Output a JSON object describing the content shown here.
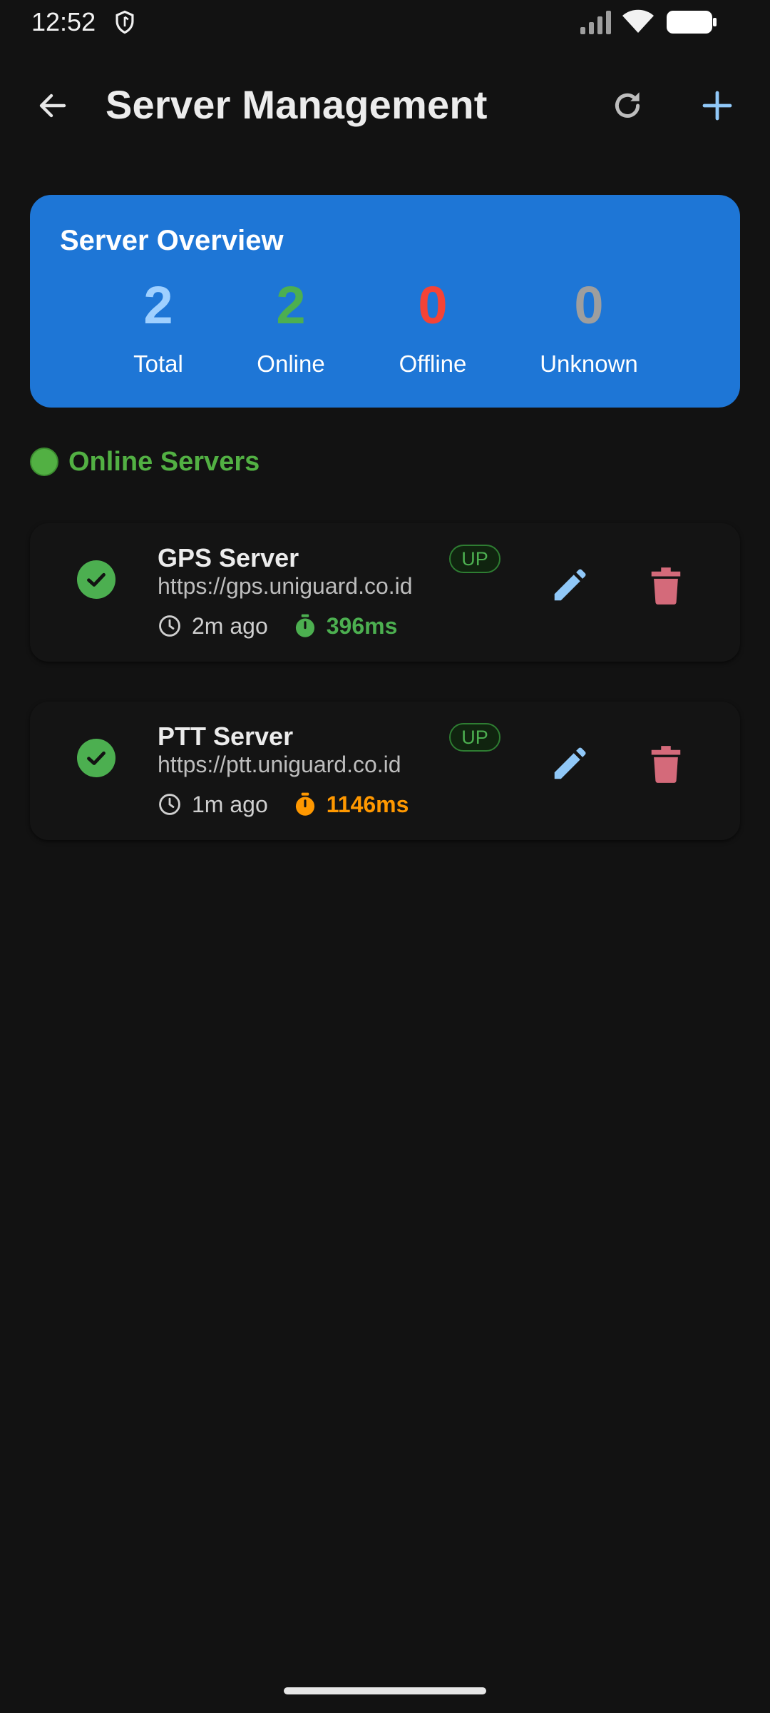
{
  "status_bar": {
    "time": "12:52",
    "icons": [
      "shield-icon",
      "signal-icon",
      "wifi-icon",
      "battery-icon"
    ]
  },
  "app_bar": {
    "title": "Server Management",
    "icons": {
      "back": "arrow-left-icon",
      "refresh": "refresh-icon",
      "add": "plus-icon"
    }
  },
  "overview": {
    "title": "Server Overview",
    "stats": [
      {
        "value": "2",
        "label": "Total",
        "color": "#9fd0ff"
      },
      {
        "value": "2",
        "label": "Online",
        "color": "#4caf50"
      },
      {
        "value": "0",
        "label": "Offline",
        "color": "#f44336"
      },
      {
        "value": "0",
        "label": "Unknown",
        "color": "#9e9e9e"
      }
    ],
    "background": "#1e76d6"
  },
  "section": {
    "title": "Online Servers",
    "accent": "#52b043"
  },
  "servers": [
    {
      "name": "GPS Server",
      "url": "https://gps.uniguard.co.id",
      "status": "UP",
      "ago": "2m ago",
      "latency": "396ms",
      "latency_color": "#4caf50"
    },
    {
      "name": "PTT Server",
      "url": "https://ptt.uniguard.co.id",
      "status": "UP",
      "ago": "1m ago",
      "latency": "1146ms",
      "latency_color": "#ff9800"
    }
  ],
  "colors": {
    "background": "#121212",
    "edit": "#90c8f8",
    "delete": "#d46a7a",
    "add": "#90c8f8"
  }
}
